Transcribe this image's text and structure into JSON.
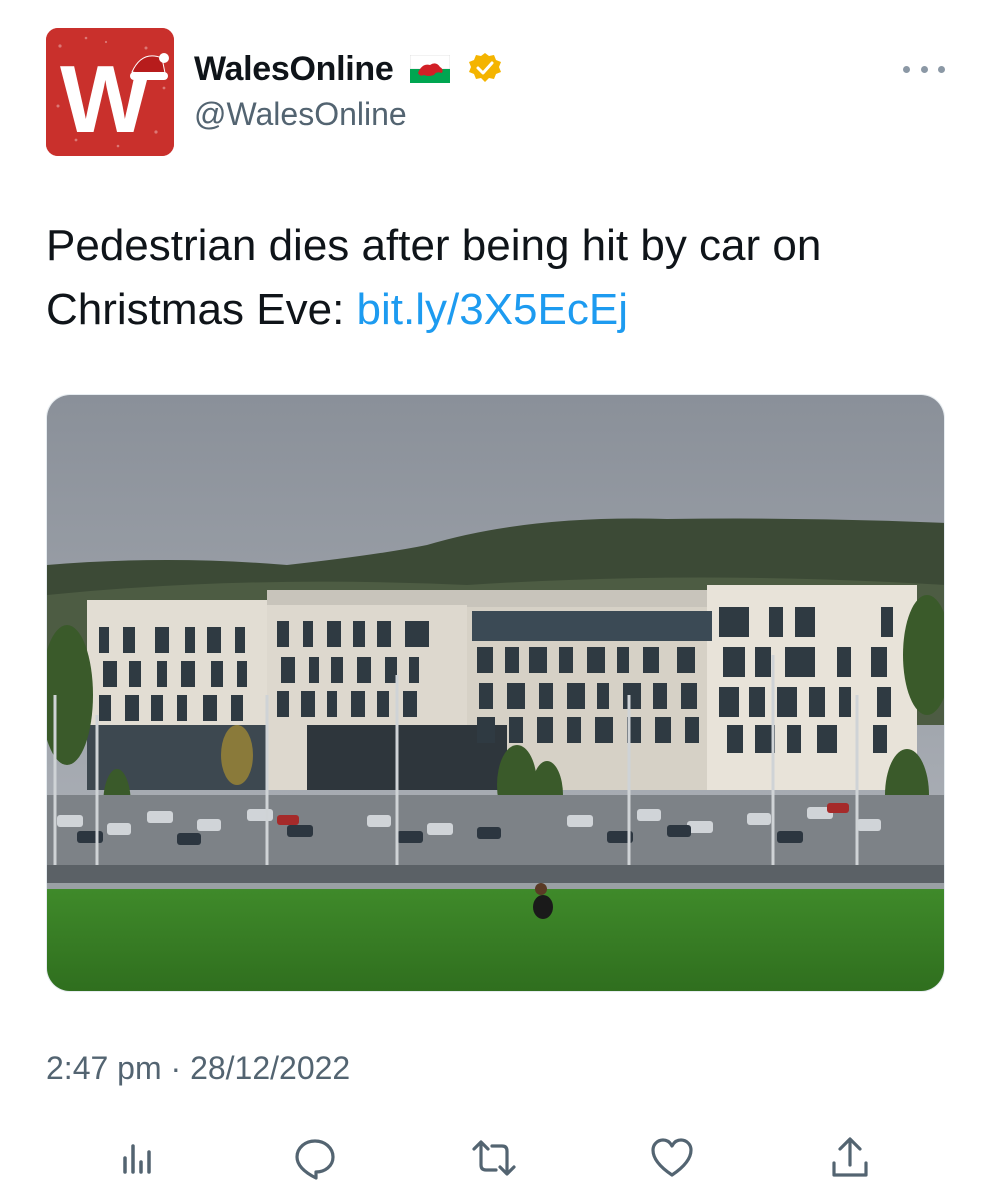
{
  "account": {
    "display_name": "WalesOnline",
    "handle": "@WalesOnline",
    "avatar_letter": "W",
    "flag_icon": "wales-flag-icon",
    "verified_icon": "verified-badge-icon",
    "brand_color": "#c9302c",
    "verified_color": "#f4c430"
  },
  "tweet": {
    "text": "Pedestrian dies after being hit by car on Christmas Eve:",
    "link": "bit.ly/3X5EcEj",
    "link_color": "#1d9bf0"
  },
  "media": {
    "description_icon": "photo-icon"
  },
  "meta": {
    "time": "2:47 pm",
    "separator": "·",
    "date": "28/12/2022"
  },
  "actions": [
    {
      "name": "analytics",
      "icon": "bar-chart-icon"
    },
    {
      "name": "reply",
      "icon": "comment-icon"
    },
    {
      "name": "retweet",
      "icon": "retweet-icon"
    },
    {
      "name": "like",
      "icon": "heart-icon"
    },
    {
      "name": "share",
      "icon": "share-icon"
    }
  ]
}
